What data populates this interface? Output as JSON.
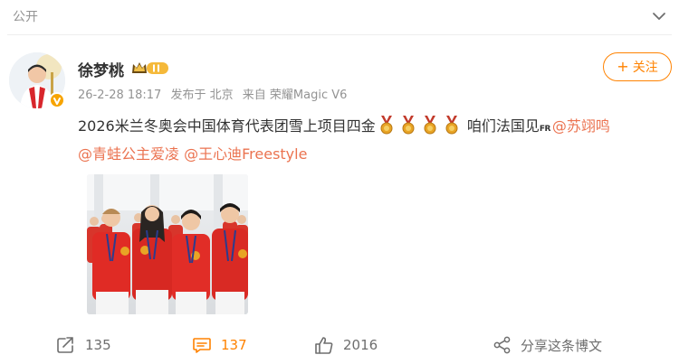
{
  "topbar": {
    "visibility_label": "公开"
  },
  "post": {
    "author": "徐梦桃",
    "timestamp": "26-2-28 18:17",
    "location": "发布于 北京",
    "source": "来自 荣耀Magic V6",
    "follow_label": "关注",
    "text_main": "2026米兰冬奥会中国体育代表团雪上项目四金",
    "text_suffix": "咱们法国见",
    "flag_text": "FR",
    "mentions": [
      "@苏翊鸣",
      "@青蛙公主爱凌",
      "@王心迪Freestyle"
    ]
  },
  "actions": {
    "share_count": "135",
    "comment_count": "137",
    "like_count": "2016",
    "share_post_label": "分享这条博文"
  },
  "colors": {
    "accent": "#ff8200",
    "mention": "#eb7350",
    "muted": "#939393"
  },
  "icons": [
    "chevron-down-icon",
    "verified-badge-icon",
    "vip-crown-icon",
    "gold-medal-icon",
    "repost-icon",
    "comment-icon",
    "like-icon",
    "share-icon"
  ]
}
